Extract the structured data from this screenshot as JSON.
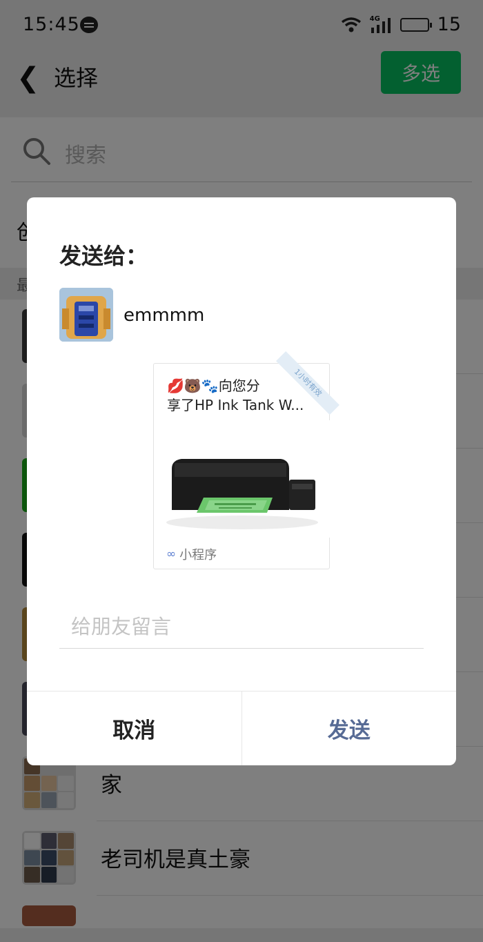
{
  "status_bar": {
    "time": "15:45",
    "network": "4G",
    "battery": "15"
  },
  "header": {
    "title": "选择",
    "multi_select": "多选"
  },
  "search": {
    "placeholder": "搜索"
  },
  "background_list": {
    "create_label": "创",
    "section_label": "最",
    "visible_chats": [
      "家",
      "老司机是真土豪"
    ]
  },
  "dialog": {
    "title": "发送给：",
    "recipient": "emmmm",
    "card": {
      "line1": "💋🐻🐾向您分",
      "line2": "享了HP Ink Tank W...",
      "ribbon": "1小时有效",
      "footer": "小程序"
    },
    "message_placeholder": "给朋友留言",
    "cancel": "取消",
    "send": "发送"
  },
  "colors": {
    "accent_green": "#07c160",
    "send_blue": "#576b95"
  }
}
